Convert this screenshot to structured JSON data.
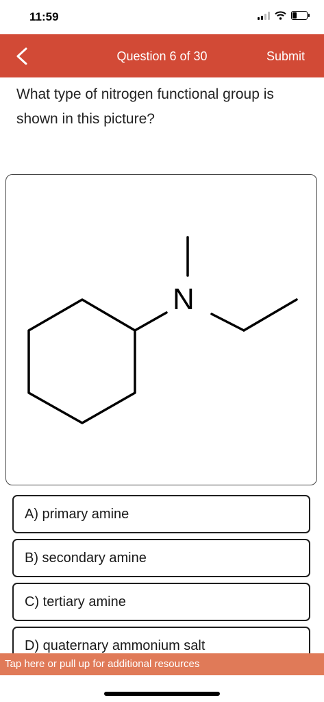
{
  "status_bar": {
    "time": "11:59"
  },
  "header": {
    "back_icon": "chevron-left-icon",
    "title": "Question 6 of 30",
    "submit_label": "Submit",
    "background_color": "#d24a36"
  },
  "question": {
    "text": "What type of nitrogen functional group is shown in this picture?"
  },
  "figure": {
    "atom_label": "N"
  },
  "options": [
    {
      "label": "A) primary amine"
    },
    {
      "label": "B) secondary amine"
    },
    {
      "label": "C) tertiary amine"
    },
    {
      "label": "D) quaternary ammonium salt"
    }
  ],
  "resources_bar": {
    "text": "Tap here or pull up for additional resources",
    "background_color": "#e07a58"
  }
}
